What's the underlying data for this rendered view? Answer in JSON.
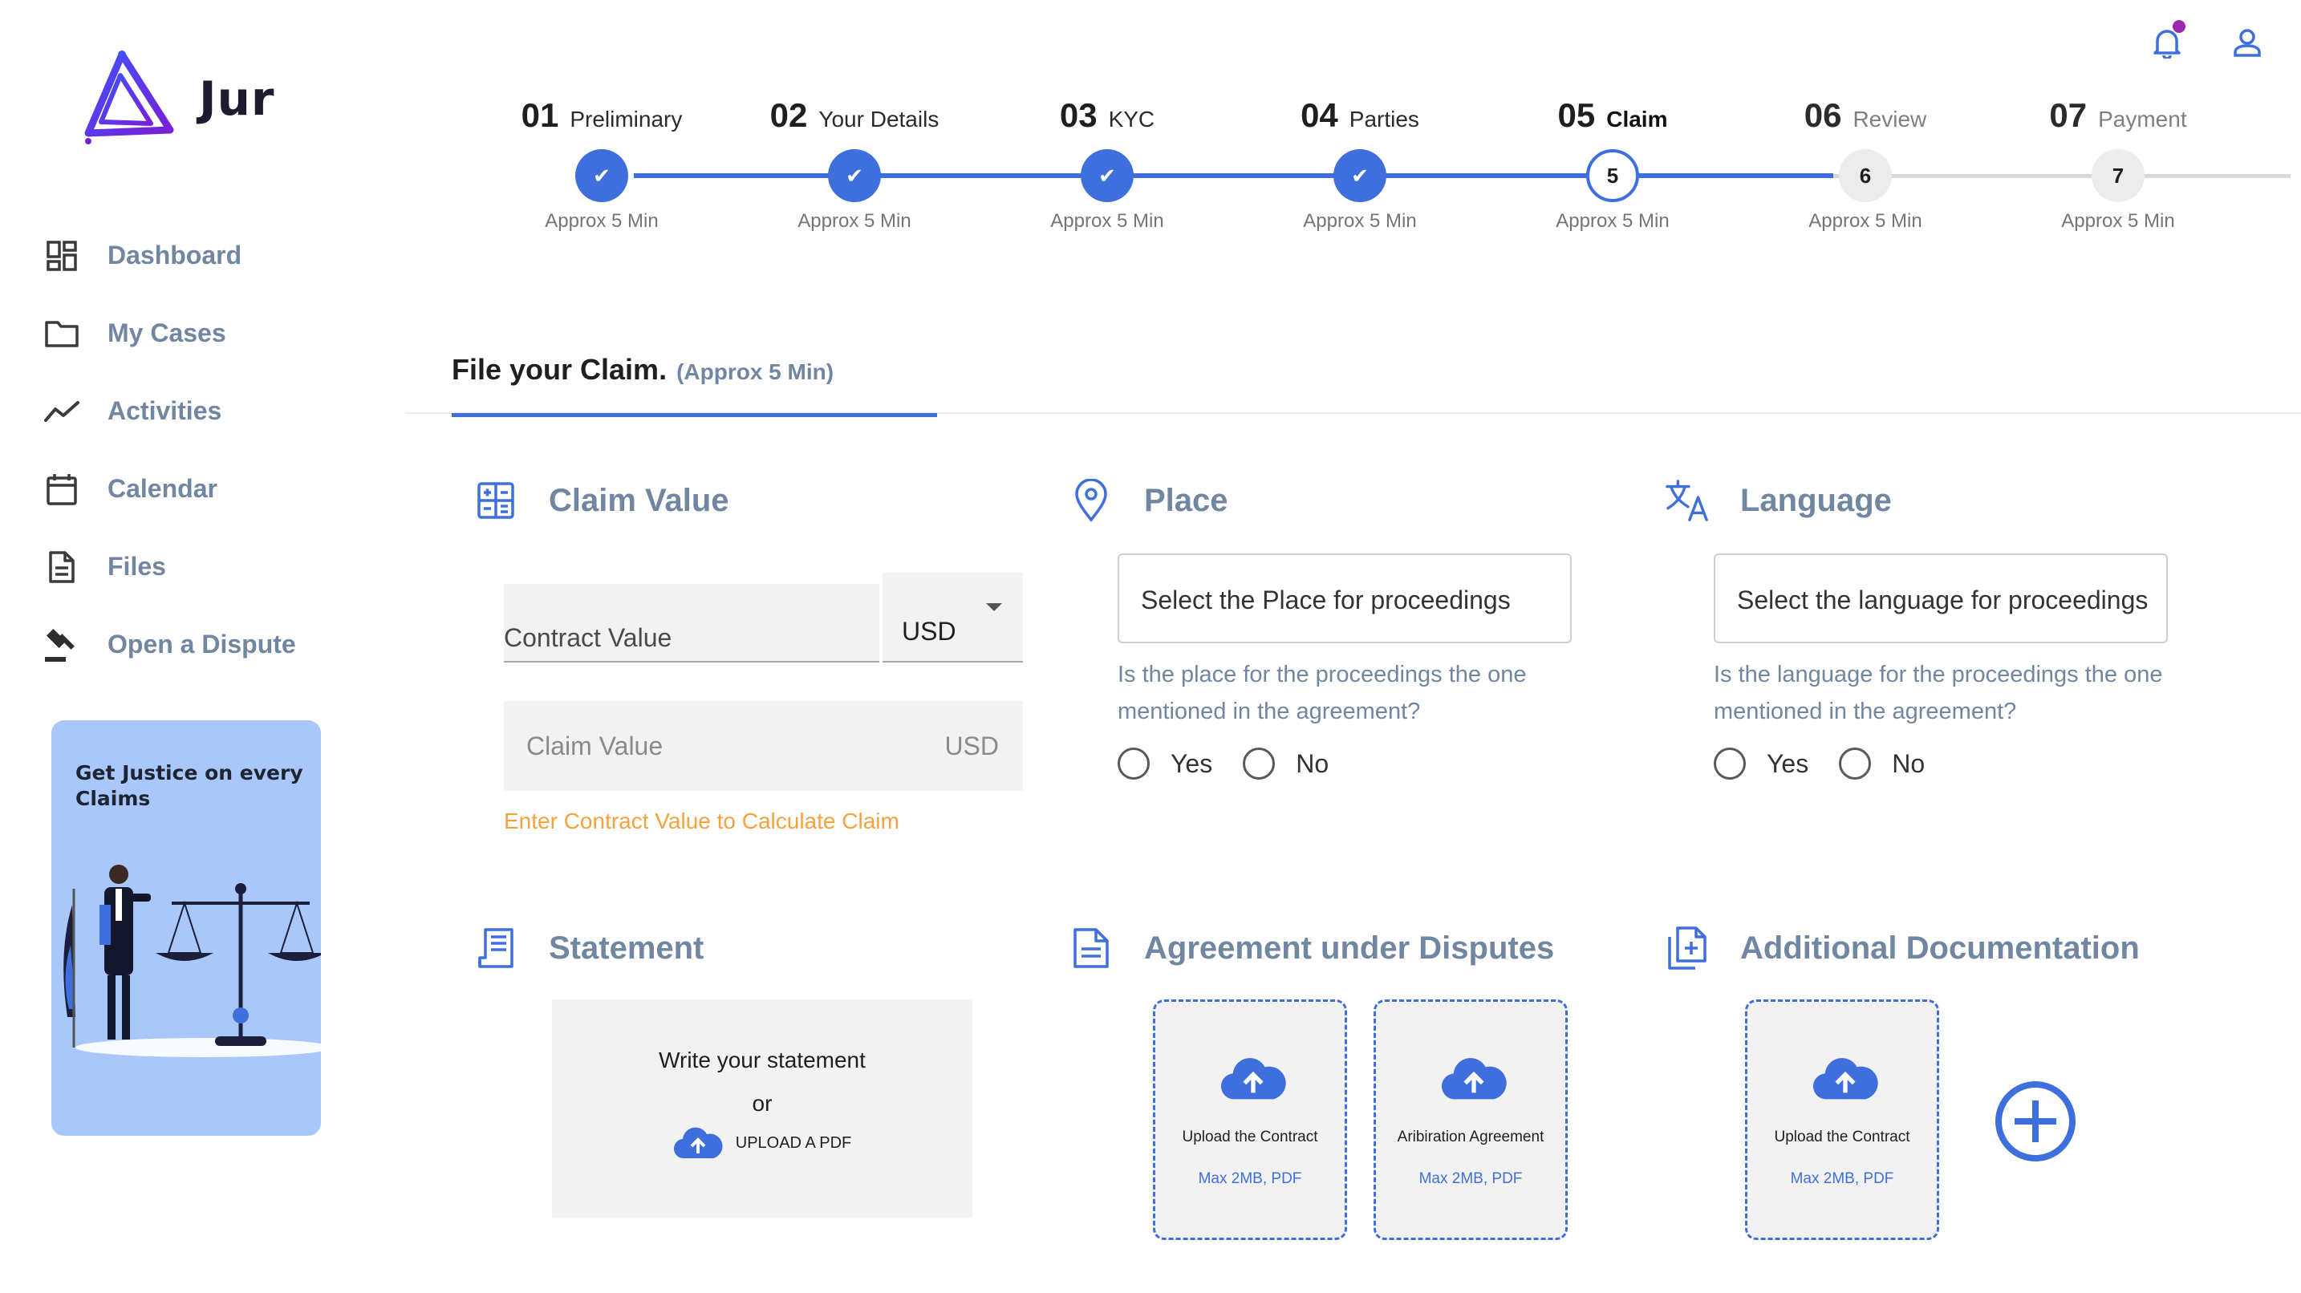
{
  "app": {
    "name": "Jur"
  },
  "sidebar": {
    "items": [
      {
        "label": "Dashboard",
        "icon": "dashboard-icon"
      },
      {
        "label": "My Cases",
        "icon": "folder-icon"
      },
      {
        "label": "Activities",
        "icon": "activity-chart-icon"
      },
      {
        "label": "Calendar",
        "icon": "calendar-icon"
      },
      {
        "label": "Files",
        "icon": "file-icon"
      },
      {
        "label": "Open a Dispute",
        "icon": "gavel-icon"
      }
    ],
    "promo": {
      "text": "Get Justice on every Claims"
    }
  },
  "header": {
    "icons": [
      "notification-bell-icon",
      "user-profile-icon"
    ],
    "has_notification": true
  },
  "stepper": {
    "steps": [
      {
        "num": "01",
        "name": "Preliminary",
        "marker": "✔",
        "status": "done",
        "approx": "Approx 5 Min"
      },
      {
        "num": "02",
        "name": "Your Details",
        "marker": "✔",
        "status": "done",
        "approx": "Approx 5 Min"
      },
      {
        "num": "03",
        "name": "KYC",
        "marker": "✔",
        "status": "done",
        "approx": "Approx 5 Min"
      },
      {
        "num": "04",
        "name": "Parties",
        "marker": "✔",
        "status": "done",
        "approx": "Approx 5 Min"
      },
      {
        "num": "05",
        "name": "Claim",
        "marker": "5",
        "status": "current",
        "approx": "Approx 5 Min"
      },
      {
        "num": "06",
        "name": "Review",
        "marker": "6",
        "status": "upcoming",
        "approx": "Approx 5 Min"
      },
      {
        "num": "07",
        "name": "Payment",
        "marker": "7",
        "status": "upcoming",
        "approx": "Approx 5 Min"
      }
    ]
  },
  "tab": {
    "title": "File your Claim.",
    "approx": "(Approx 5 Min)"
  },
  "claim_value": {
    "title": "Claim Value",
    "contract_label": "Contract Value",
    "currency": "USD",
    "claim_placeholder": "Claim Value",
    "claim_currency": "USD",
    "hint": "Enter Contract Value to Calculate Claim"
  },
  "place": {
    "title": "Place",
    "select_placeholder": "Select the Place for proceedings",
    "question": "Is the place for the proceedings the one mentioned in the agreement?",
    "yes": "Yes",
    "no": "No"
  },
  "language": {
    "title": "Language",
    "select_placeholder": "Select the language for proceedings",
    "question": "Is the language for the proceedings the one mentioned in the agreement?",
    "yes": "Yes",
    "no": "No"
  },
  "statement": {
    "title": "Statement",
    "write": "Write your statement",
    "or": "or",
    "upload": "UPLOAD A PDF"
  },
  "agreement": {
    "title": "Agreement under Disputes",
    "cards": [
      {
        "name": "Upload the Contract",
        "spec": "Max 2MB, PDF"
      },
      {
        "name": "Aribiration Agreement",
        "spec": "Max 2MB, PDF"
      }
    ]
  },
  "additional": {
    "title": "Additional Documentation",
    "cards": [
      {
        "name": "Upload the Contract",
        "spec": "Max 2MB, PDF"
      }
    ]
  },
  "colors": {
    "accent": "#3e6fdc",
    "muted": "#7186a0",
    "warning": "#f4a23d",
    "promo_bg": "#a9c7f9",
    "notification": "#9c27b0"
  }
}
